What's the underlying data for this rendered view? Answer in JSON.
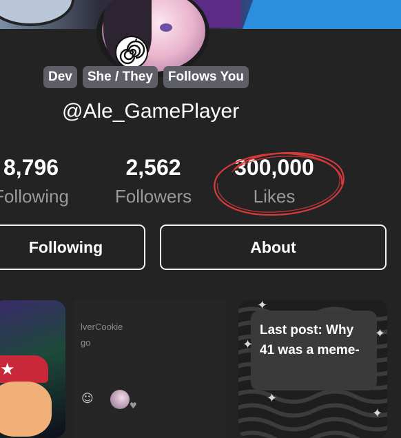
{
  "profile": {
    "badges": [
      "Dev",
      "She / They",
      "Follows You"
    ],
    "username": "@Ale_GamePlayer"
  },
  "stats": {
    "following_count": "8,796",
    "following_label": "Following",
    "followers_count": "2,562",
    "followers_label": "Followers",
    "likes_count": "300,000",
    "likes_label": "Likes"
  },
  "buttons": {
    "following": "Following",
    "about": "About"
  },
  "feed": {
    "middle_user": "lverCookie",
    "middle_time": "go",
    "last_post": "Last post: Why 41 was a meme-"
  },
  "colors": {
    "background": "#232323",
    "badge": "#5e5e66",
    "circle_annotation": "#d63a3a",
    "muted_text": "#9a9a9a"
  },
  "icons": [
    "spiral-icon",
    "sparkle-icon",
    "add-sticker-icon",
    "heart-icon"
  ]
}
